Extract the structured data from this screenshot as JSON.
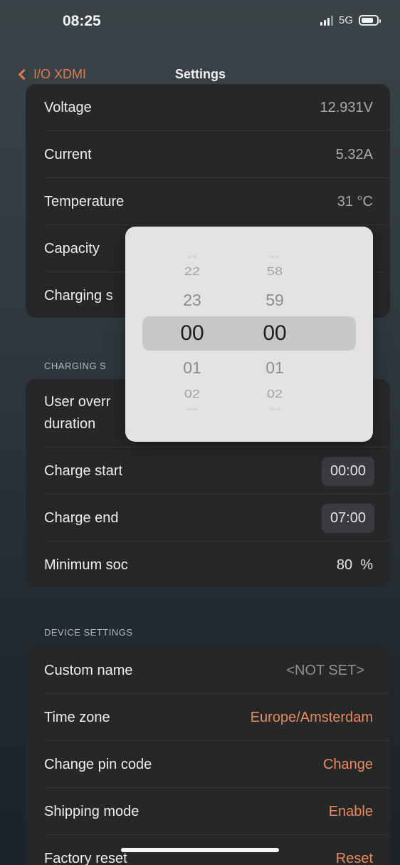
{
  "status": {
    "time": "08:25",
    "network": "5G"
  },
  "nav": {
    "back_label": "I/O XDMI",
    "title": "Settings"
  },
  "battery_section": {
    "rows": [
      {
        "label": "Voltage",
        "value": "12.931V"
      },
      {
        "label": "Current",
        "value": "5.32A"
      },
      {
        "label": "Temperature",
        "value": "31 °C"
      },
      {
        "label": "Capacity",
        "value": ""
      },
      {
        "label": "Charging s",
        "value": ""
      }
    ]
  },
  "charging_section": {
    "header": "CHARGING S",
    "user_override": {
      "line1": "User overr",
      "line2": "duration"
    },
    "charge_start": {
      "label": "Charge start",
      "value": "00:00"
    },
    "charge_end": {
      "label": "Charge end",
      "value": "07:00"
    },
    "minimum_soc": {
      "label": "Minimum soc",
      "value": "80  %"
    }
  },
  "device_section": {
    "header": "DEVICE SETTINGS",
    "rows": [
      {
        "label": "Custom name",
        "value": "<NOT SET>"
      },
      {
        "label": "Time zone",
        "value": "Europe/Amsterdam"
      },
      {
        "label": "Change pin code",
        "value": "Change"
      },
      {
        "label": "Shipping mode",
        "value": "Enable"
      },
      {
        "label": "Factory reset",
        "value": "Reset"
      }
    ]
  },
  "time_picker": {
    "hours": [
      "21",
      "22",
      "23",
      "00",
      "01",
      "02",
      "03"
    ],
    "minutes": [
      "57",
      "58",
      "59",
      "00",
      "01",
      "02",
      "03"
    ],
    "selected_hour": "00",
    "selected_minute": "00"
  },
  "colors": {
    "accent": "#e07a4a",
    "value_accent": "#e88a5c",
    "card_bg": "#262729"
  }
}
